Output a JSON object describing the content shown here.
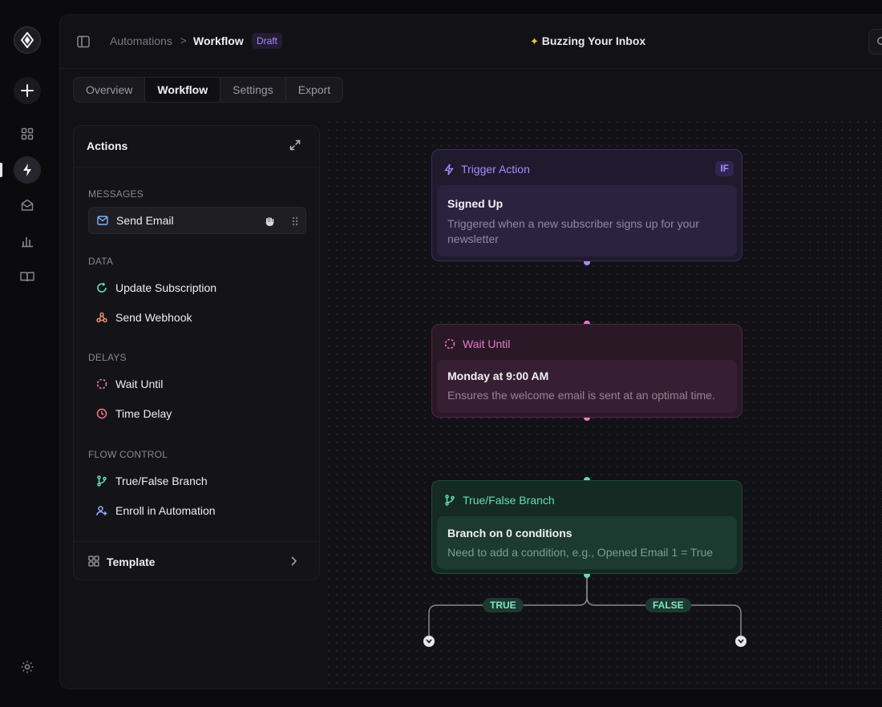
{
  "header": {
    "breadcrumb_root": "Automations",
    "breadcrumb_separator": ">",
    "breadcrumb_current": "Workflow",
    "status_badge": "Draft",
    "title": "Buzzing Your Inbox"
  },
  "tabs": [
    {
      "label": "Overview"
    },
    {
      "label": "Workflow",
      "active": true
    },
    {
      "label": "Settings"
    },
    {
      "label": "Export"
    }
  ],
  "actions_panel": {
    "title": "Actions",
    "sections": {
      "messages": "MESSAGES",
      "data": "DATA",
      "delays": "DELAYS",
      "flow_control": "FLOW CONTROL"
    },
    "items": {
      "send_email": "Send Email",
      "update_subscription": "Update Subscription",
      "send_webhook": "Send Webhook",
      "wait_until": "Wait Until",
      "time_delay": "Time Delay",
      "true_false_branch": "True/False Branch",
      "enroll_in_automation": "Enroll in Automation"
    },
    "template_label": "Template"
  },
  "nodes": {
    "trigger": {
      "header": "Trigger Action",
      "badge": "IF",
      "title": "Signed Up",
      "description": "Triggered when a new subscriber signs up for your newsletter",
      "color": "#a78bfa"
    },
    "wait": {
      "header": "Wait Until",
      "title": "Monday at 9:00 AM",
      "description": "Ensures the welcome email is sent at an optimal time.",
      "color": "#e879c8"
    },
    "branch": {
      "header": "True/False Branch",
      "title": "Branch on 0 conditions",
      "description": "Need to add a condition, e.g., Opened Email 1 = True",
      "color": "#5ee0b0",
      "true_label": "TRUE",
      "false_label": "FALSE"
    }
  },
  "icons": {
    "rail": [
      "logo-icon",
      "plus-icon",
      "grid-icon",
      "bolt-icon",
      "mail-open-icon",
      "bar-chart-icon",
      "book-icon",
      "gear-icon"
    ]
  },
  "colors": {
    "accent_purple": "#a78bfa",
    "accent_pink": "#e879c8",
    "accent_green": "#5ee0b0"
  }
}
